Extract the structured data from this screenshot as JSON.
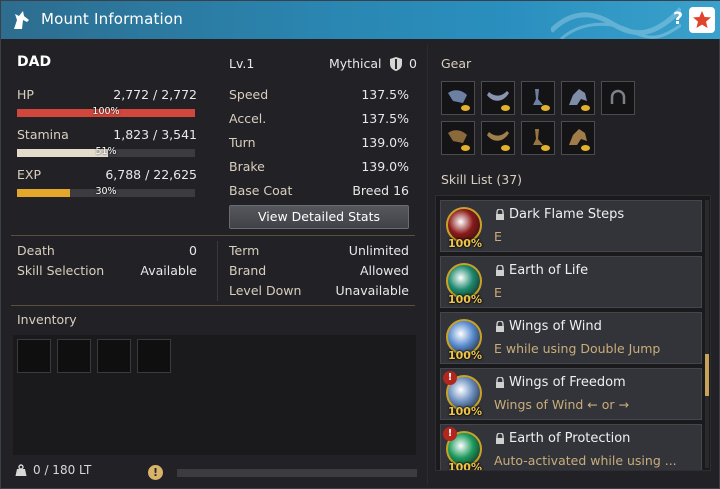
{
  "window": {
    "title": "Mount Information",
    "help_label": "?"
  },
  "mount": {
    "name": "DAD",
    "level": "Lv.1",
    "grade": "Mythical",
    "grade_count": "0"
  },
  "bars": {
    "hp": {
      "label": "HP",
      "value": "2,772 / 2,772",
      "pct_label": "100%",
      "fill": 1.0,
      "color": "#d2473b"
    },
    "stamina": {
      "label": "Stamina",
      "value": "1,823 / 3,541",
      "pct_label": "51%",
      "fill": 0.51,
      "color": "#e3dccd"
    },
    "exp": {
      "label": "EXP",
      "value": "6,788 / 22,625",
      "pct_label": "30%",
      "fill": 0.3,
      "color": "#e3a82a"
    }
  },
  "stats": [
    {
      "label": "Speed",
      "value": "137.5%"
    },
    {
      "label": "Accel.",
      "value": "137.5%"
    },
    {
      "label": "Turn",
      "value": "139.0%"
    },
    {
      "label": "Brake",
      "value": "139.0%"
    },
    {
      "label": "Base Coat",
      "value": "Breed 16"
    }
  ],
  "view_stats_button": "View Detailed Stats",
  "info_left": [
    {
      "label": "Death",
      "value": "0"
    },
    {
      "label": "Skill Selection",
      "value": "Available"
    }
  ],
  "info_right": [
    {
      "label": "Term",
      "value": "Unlimited"
    },
    {
      "label": "Brand",
      "value": "Allowed"
    },
    {
      "label": "Level Down",
      "value": "Unavailable"
    }
  ],
  "inventory": {
    "title": "Inventory",
    "weight": "0 / 180 LT",
    "warn_icon": "!"
  },
  "gear": {
    "title": "Gear"
  },
  "skills": {
    "title": "Skill List (37)",
    "items": [
      {
        "name": "Dark Flame Steps",
        "desc": "E",
        "pct": "100%",
        "warn": false,
        "color": "#8b1a1a"
      },
      {
        "name": "Earth of Life",
        "desc": "E",
        "pct": "100%",
        "warn": false,
        "color": "#1f8a6e"
      },
      {
        "name": "Wings of Wind",
        "desc": "E while using Double Jump",
        "pct": "100%",
        "warn": false,
        "color": "#5a8ccf"
      },
      {
        "name": "Wings of Freedom",
        "desc": "Wings of Wind ← or →",
        "pct": "100%",
        "warn": true,
        "warn_label": "!",
        "color": "#6c8fbf"
      },
      {
        "name": "Earth of Protection",
        "desc": "Auto-activated while using ...",
        "pct": "100%",
        "warn": true,
        "warn_label": "!",
        "color": "#1f9b5e"
      }
    ]
  }
}
